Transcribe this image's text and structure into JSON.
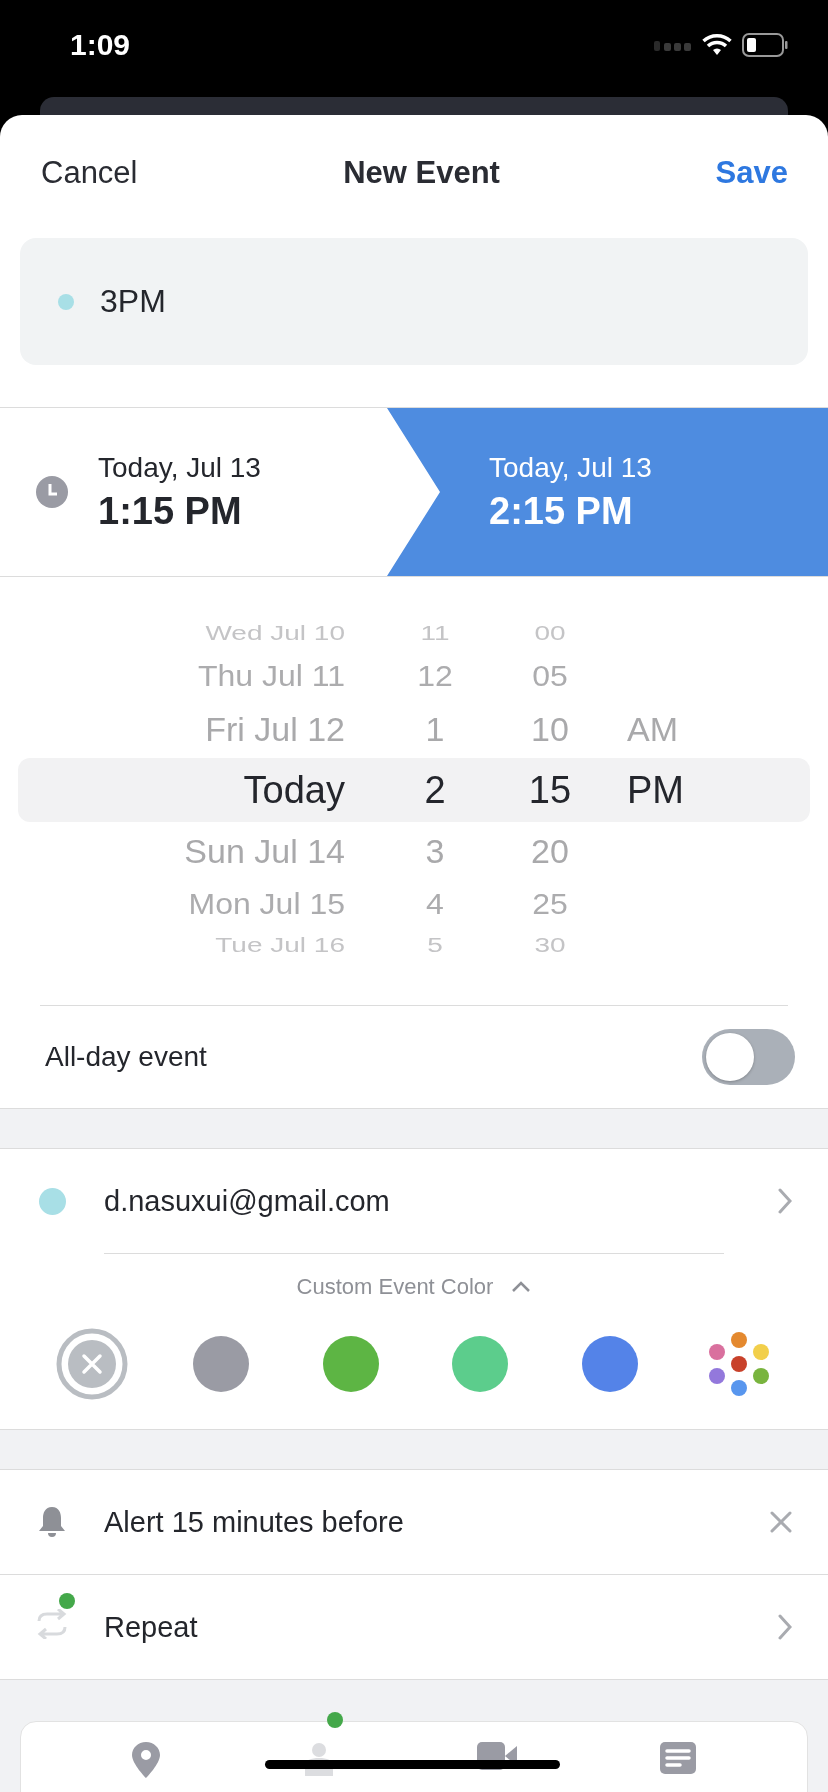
{
  "status_bar": {
    "time": "1:09"
  },
  "header": {
    "cancel": "Cancel",
    "title": "New Event",
    "save": "Save"
  },
  "title_field": {
    "value": "3PM",
    "color": "#a8dfe6"
  },
  "times": [
    {
      "date": "Today, Jul 13",
      "time": "1:15 PM",
      "selected": false
    },
    {
      "date": "Today, Jul 13",
      "time": "2:15 PM",
      "selected": true
    }
  ],
  "picker": {
    "columns": [
      {
        "kind": "date",
        "items": [
          {
            "label": "Wed Jul 10",
            "selected": false
          },
          {
            "label": "Thu Jul 11",
            "selected": false
          },
          {
            "label": "Fri Jul 12",
            "selected": false
          },
          {
            "label": "Today",
            "selected": true
          },
          {
            "label": "Sun Jul 14",
            "selected": false
          },
          {
            "label": "Mon Jul 15",
            "selected": false
          },
          {
            "label": "Tue Jul 16",
            "selected": false
          }
        ]
      },
      {
        "kind": "hour",
        "items": [
          {
            "label": "11",
            "selected": false
          },
          {
            "label": "12",
            "selected": false
          },
          {
            "label": "1",
            "selected": false
          },
          {
            "label": "2",
            "selected": true
          },
          {
            "label": "3",
            "selected": false
          },
          {
            "label": "4",
            "selected": false
          },
          {
            "label": "5",
            "selected": false
          }
        ]
      },
      {
        "kind": "minute",
        "items": [
          {
            "label": "00",
            "selected": false
          },
          {
            "label": "05",
            "selected": false
          },
          {
            "label": "10",
            "selected": false
          },
          {
            "label": "15",
            "selected": true
          },
          {
            "label": "20",
            "selected": false
          },
          {
            "label": "25",
            "selected": false
          },
          {
            "label": "30",
            "selected": false
          }
        ]
      },
      {
        "kind": "meridiem",
        "items": [
          {
            "label": "AM",
            "selected": false
          },
          {
            "label": "PM",
            "selected": true
          }
        ]
      }
    ]
  },
  "all_day": {
    "label": "All-day event",
    "on": false
  },
  "account": {
    "email": "d.nasuxui@gmail.com",
    "color": "#a8dfe6"
  },
  "custom_color": {
    "label": "Custom Event Color",
    "expanded": true,
    "options": [
      {
        "kind": "none",
        "selected": true
      },
      {
        "kind": "swatch",
        "color": "#9a9ba4",
        "selected": false
      },
      {
        "kind": "swatch",
        "color": "#5db544",
        "selected": false
      },
      {
        "kind": "swatch",
        "color": "#5ccd8c",
        "selected": false
      },
      {
        "kind": "swatch",
        "color": "#5483e8",
        "selected": false
      },
      {
        "kind": "palette",
        "selected": false
      }
    ]
  },
  "alert": {
    "label": "Alert 15 minutes before"
  },
  "repeat": {
    "label": "Repeat"
  }
}
